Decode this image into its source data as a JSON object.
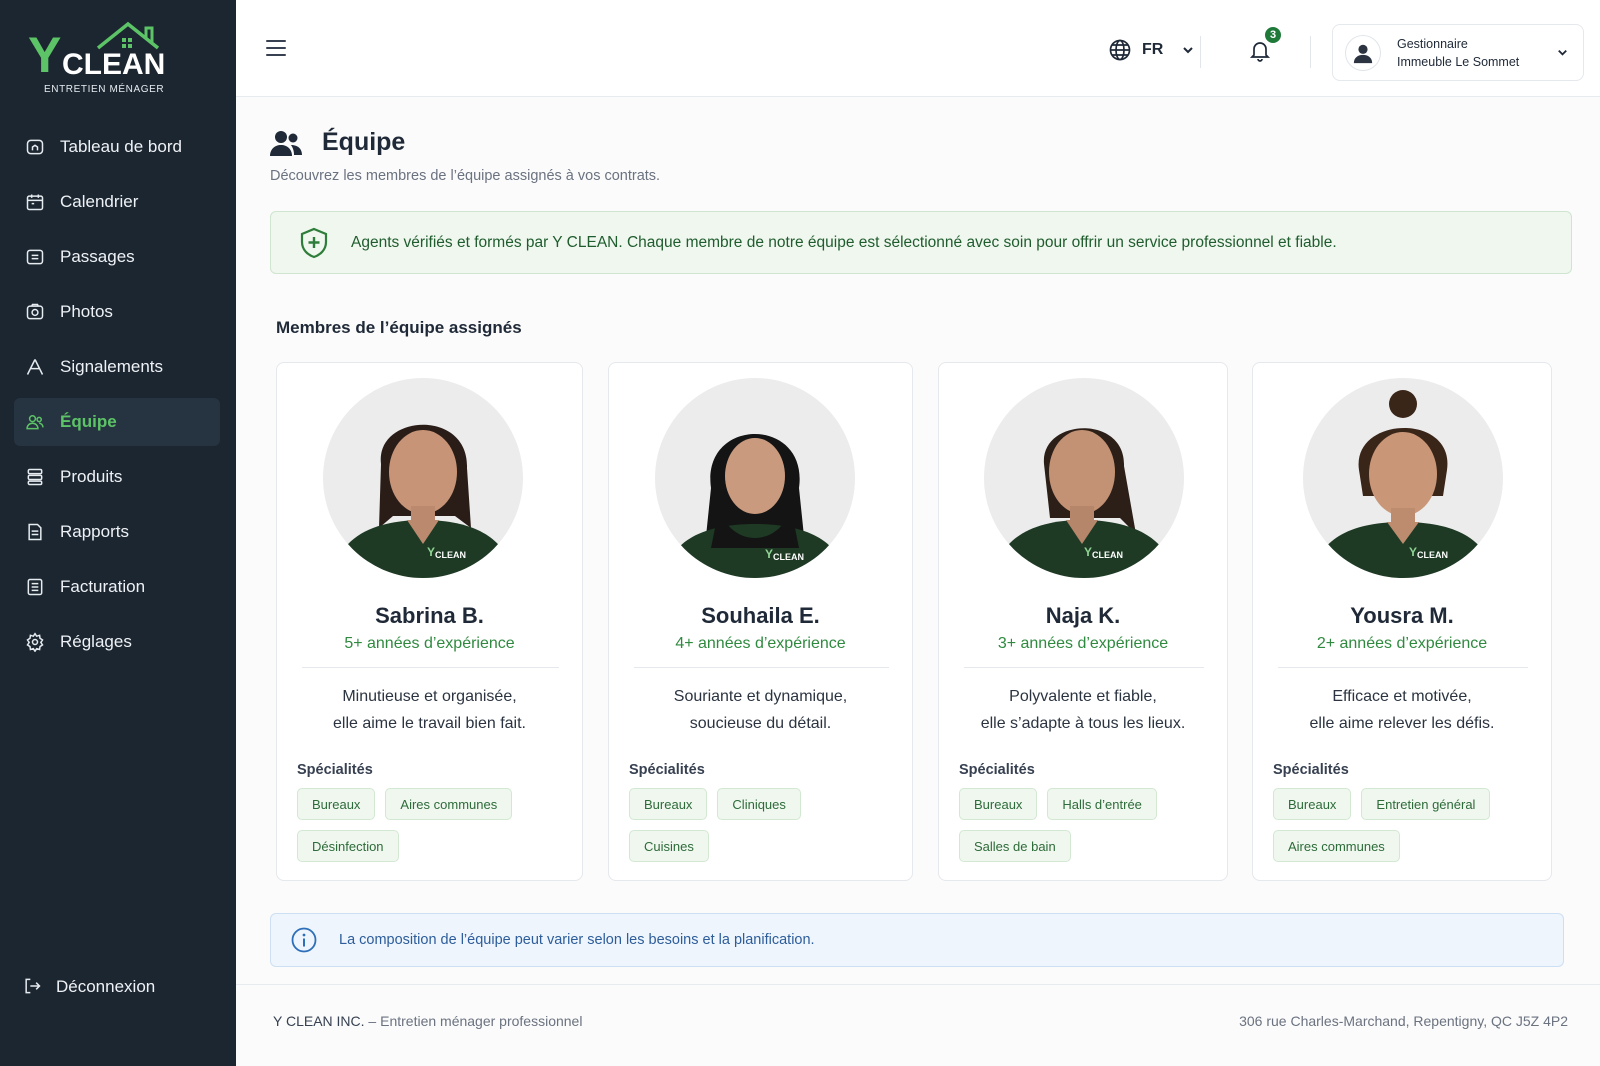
{
  "brand": {
    "logo_text": "CLEAN",
    "logo_letter": "Y",
    "tagline": "ENTRETIEN MÉNAGER",
    "accent": "#5cc466",
    "sidebar_bg": "#1c2630"
  },
  "sidebar": {
    "items": [
      {
        "label": "Tableau de bord",
        "icon": "home-icon"
      },
      {
        "label": "Calendrier",
        "icon": "calendar-icon"
      },
      {
        "label": "Passages",
        "icon": "list-icon"
      },
      {
        "label": "Photos",
        "icon": "camera-icon"
      },
      {
        "label": "Signalements",
        "icon": "alert-icon"
      },
      {
        "label": "Équipe",
        "icon": "team-icon",
        "active": true
      },
      {
        "label": "Produits",
        "icon": "products-icon"
      },
      {
        "label": "Rapports",
        "icon": "report-icon"
      },
      {
        "label": "Facturation",
        "icon": "billing-icon"
      },
      {
        "label": "Réglages",
        "icon": "gear-icon"
      }
    ],
    "logout": "Déconnexion"
  },
  "header": {
    "language": "FR",
    "notifications_count": "3",
    "user_role": "Gestionnaire",
    "user_org": "Immeuble Le Sommet"
  },
  "main": {
    "title": "Équipe",
    "subtitle": "Découvrez les membres de l’équipe assignés à vos contrats.",
    "verified_notice": "Agents vérifiés et formés par Y CLEAN. Chaque membre de notre équipe est sélectionné avec soin pour offrir un service professionnel et fiable.",
    "section_title": "Membres de l’équipe assignés",
    "specialties_label": "Spécialités",
    "members": [
      {
        "name": "Sabrina B.",
        "experience": "5+ années d’expérience",
        "desc_1": "Minutieuse et organisée,",
        "desc_2": "elle aime le travail bien fait.",
        "tags": [
          "Bureaux",
          "Aires communes",
          "Désinfection"
        ]
      },
      {
        "name": "Souhaila E.",
        "experience": "4+ années d’expérience",
        "desc_1": "Souriante et dynamique,",
        "desc_2": "soucieuse du détail.",
        "tags": [
          "Bureaux",
          "Cliniques",
          "Cuisines"
        ]
      },
      {
        "name": "Naja K.",
        "experience": "3+ années d’expérience",
        "desc_1": "Polyvalente et fiable,",
        "desc_2": "elle s’adapte à tous les lieux.",
        "tags": [
          "Bureaux",
          "Halls d’entrée",
          "Salles de bain"
        ]
      },
      {
        "name": "Yousra M.",
        "experience": "2+ années d’expérience",
        "desc_1": "Efficace et motivée,",
        "desc_2": "elle aime relever les défis.",
        "tags": [
          "Bureaux",
          "Entretien général",
          "Aires communes"
        ]
      }
    ],
    "info_notice": "La composition de l’équipe peut varier selon les besoins et la planification."
  },
  "footer": {
    "company": "Y CLEAN INC.",
    "company_tagline": " – Entretien ménager professionnel",
    "address": "306 rue Charles-Marchand, Repentigny, QC J5Z 4P2"
  }
}
